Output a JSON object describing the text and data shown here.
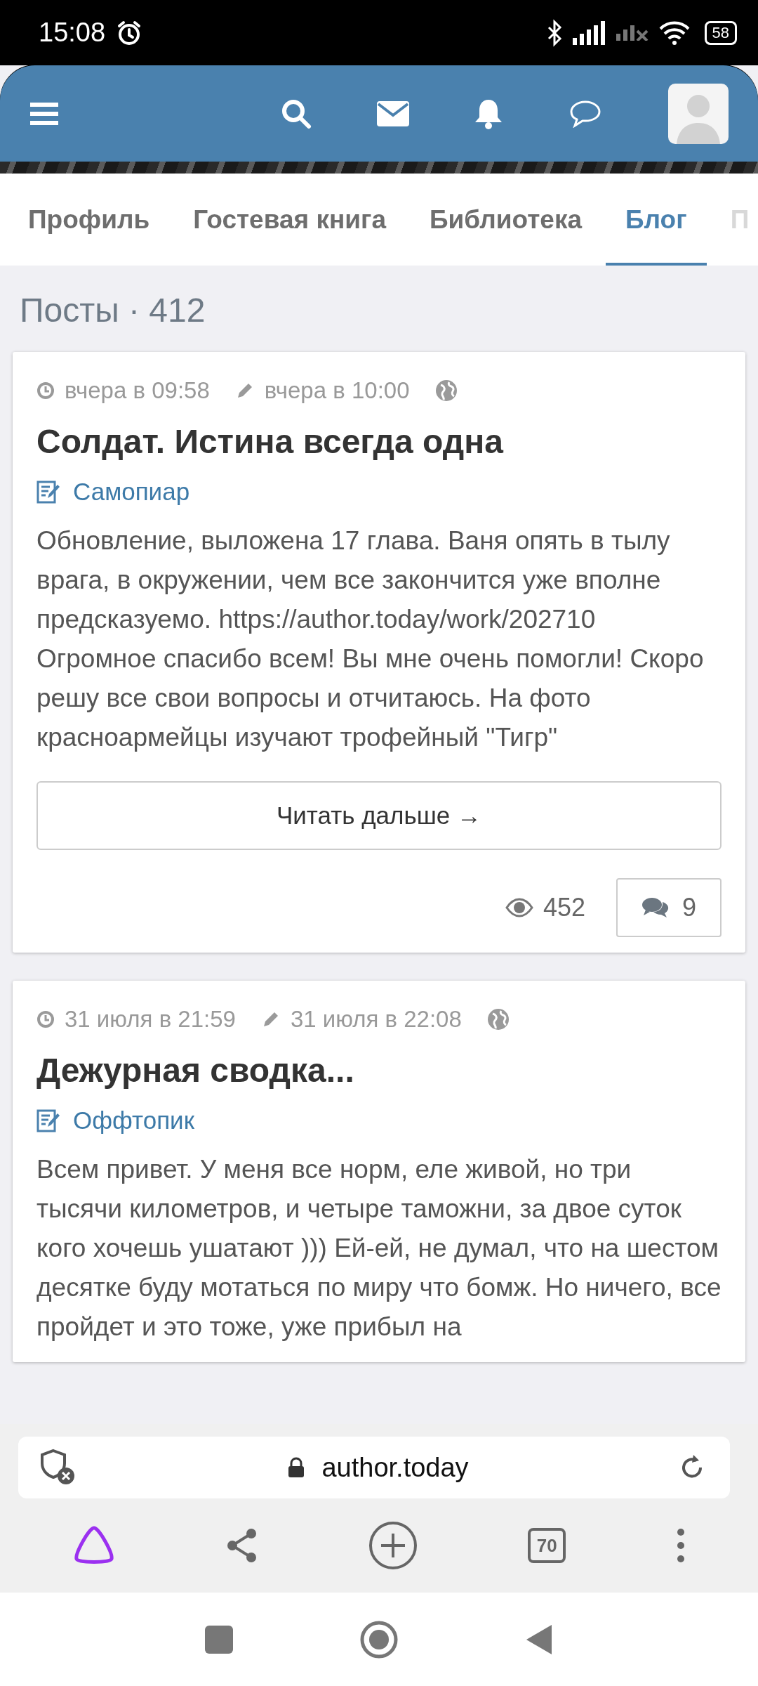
{
  "status_bar": {
    "time": "15:08",
    "battery": "58"
  },
  "tabs": [
    {
      "label": "Профиль",
      "selected": false
    },
    {
      "label": "Гостевая книга",
      "selected": false
    },
    {
      "label": "Библиотека",
      "selected": false
    },
    {
      "label": "Блог",
      "selected": true
    },
    {
      "label": "П",
      "selected": false,
      "kind": "cut"
    }
  ],
  "section_title": "Посты · 412",
  "posts": [
    {
      "created": "вчера в 09:58",
      "edited": "вчера в 10:00",
      "title": "Солдат. Истина всегда одна",
      "category": "Самопиар",
      "body": "Обновление, выложена 17 глава. Ваня опять в тылу врага, в окружении, чем все закончится уже вполне предсказуемо. https://author.today/work/202710 Огромное спасибо всем! Вы мне очень помогли! Скоро решу все свои вопросы и отчитаюсь. На фото красноармейцы изучают трофейный \"Тигр\"",
      "read_more": "Читать дальше →",
      "views": "452",
      "comments": "9"
    },
    {
      "created": "31 июля в 21:59",
      "edited": "31 июля в 22:08",
      "title": "Дежурная сводка...",
      "category": "Оффтопик",
      "body": "Всем привет. У меня все норм, еле живой, но три тысячи километров, и четыре таможни, за двое суток кого хочешь ушатают ))) Ей-ей, не думал, что на шестом десятке буду мотаться по миру что бомж. Но ничего, все пройдет и это тоже, уже прибыл на"
    }
  ],
  "browser": {
    "url": "author.today",
    "tabs_count": "70"
  }
}
